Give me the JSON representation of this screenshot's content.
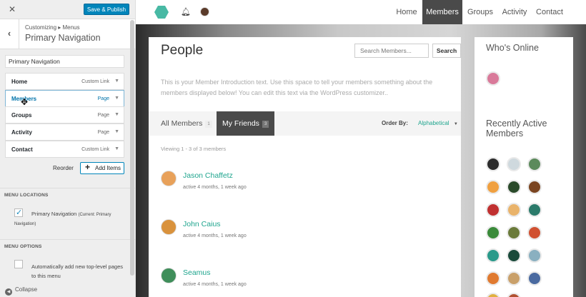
{
  "customizer": {
    "close_icon": "close-icon",
    "publish_label": "Save & Publish",
    "breadcrumb": "Customizing ▸ Menus",
    "title": "Primary Navigation",
    "menu_name_value": "Primary Navigation",
    "items": [
      {
        "label": "Home",
        "type": "Custom Link"
      },
      {
        "label": "Members",
        "type": "Page"
      },
      {
        "label": "Groups",
        "type": "Page"
      },
      {
        "label": "Activity",
        "type": "Page"
      },
      {
        "label": "Contact",
        "type": "Custom Link"
      }
    ],
    "reorder_label": "Reorder",
    "add_items_label": "Add Items",
    "menu_locations_heading": "MENU LOCATIONS",
    "location_label": "Primary Navigation",
    "location_note": "(Current: Primary Navigation)",
    "menu_options_heading": "MENU OPTIONS",
    "auto_add_label": "Automatically add new top-level pages to this menu",
    "collapse_label": "Collapse"
  },
  "site": {
    "nav": [
      "Home",
      "Members",
      "Groups",
      "Activity",
      "Contact"
    ],
    "current_nav": "Members",
    "page_title": "People",
    "search_placeholder": "Search Members...",
    "search_button": "Search",
    "intro": "This is your Member Introduction text. Use this space to tell your members something about the members displayed below! You can edit this text via the WordPress customizer..",
    "tabs": [
      {
        "label": "All Members",
        "count": "1"
      },
      {
        "label": "My Friends",
        "count": "3"
      }
    ],
    "order_by_label": "Order By:",
    "order_by_value": "Alphabetical",
    "viewing": "Viewing 1 - 3 of 3 members",
    "members": [
      {
        "name": "Jason Chaffetz",
        "activity": "active 4 months, 1 week ago"
      },
      {
        "name": "John Caius",
        "activity": "active 4 months, 1 week ago"
      },
      {
        "name": "Seamus",
        "activity": "active 4 months, 1 week ago"
      }
    ],
    "whos_online_title": "Who's Online",
    "recently_active_title": "Recently Active Members"
  },
  "colors": {
    "accent": "#1fa58e",
    "publish": "#0085ba",
    "nav_active": "#4a4a4a"
  }
}
